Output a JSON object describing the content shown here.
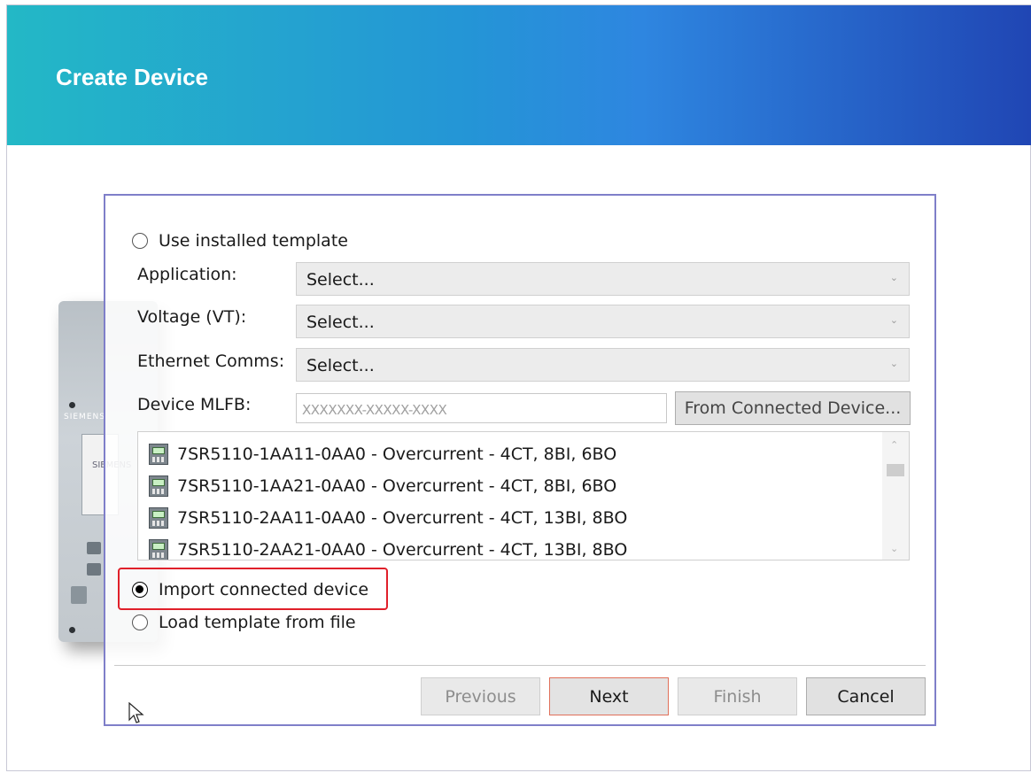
{
  "window": {
    "title": "Create Device"
  },
  "device_image": {
    "brand": "SIEMENS",
    "logo": "SIEMENS"
  },
  "options": {
    "use_template_label": "Use installed template",
    "import_device_label": "Import connected device",
    "load_file_label": "Load template from file",
    "selected": "import_connected_device"
  },
  "fields": {
    "application": {
      "label": "Application:",
      "value": "Select..."
    },
    "voltage": {
      "label": "Voltage (VT):",
      "value": "Select..."
    },
    "ethernet": {
      "label": "Ethernet Comms:",
      "value": "Select..."
    },
    "mlfb": {
      "label": "Device MLFB:",
      "placeholder": "XXXXXXX-XXXXX-XXXX"
    }
  },
  "buttons": {
    "from_connected": "From Connected Device...",
    "previous": "Previous",
    "next": "Next",
    "finish": "Finish",
    "cancel": "Cancel"
  },
  "device_list": [
    {
      "label": "7SR5110-1AA11-0AA0 - Overcurrent - 4CT, 8BI, 6BO"
    },
    {
      "label": "7SR5110-1AA21-0AA0 - Overcurrent - 4CT, 8BI, 6BO"
    },
    {
      "label": "7SR5110-2AA11-0AA0 - Overcurrent - 4CT, 13BI, 8BO"
    },
    {
      "label": "7SR5110-2AA21-0AA0 - Overcurrent - 4CT, 13BI, 8BO"
    }
  ],
  "colors": {
    "banner_start": "#23b8c6",
    "banner_end": "#2046b4",
    "highlight": "#e0202a",
    "dialog_border": "#7f7fc9"
  }
}
